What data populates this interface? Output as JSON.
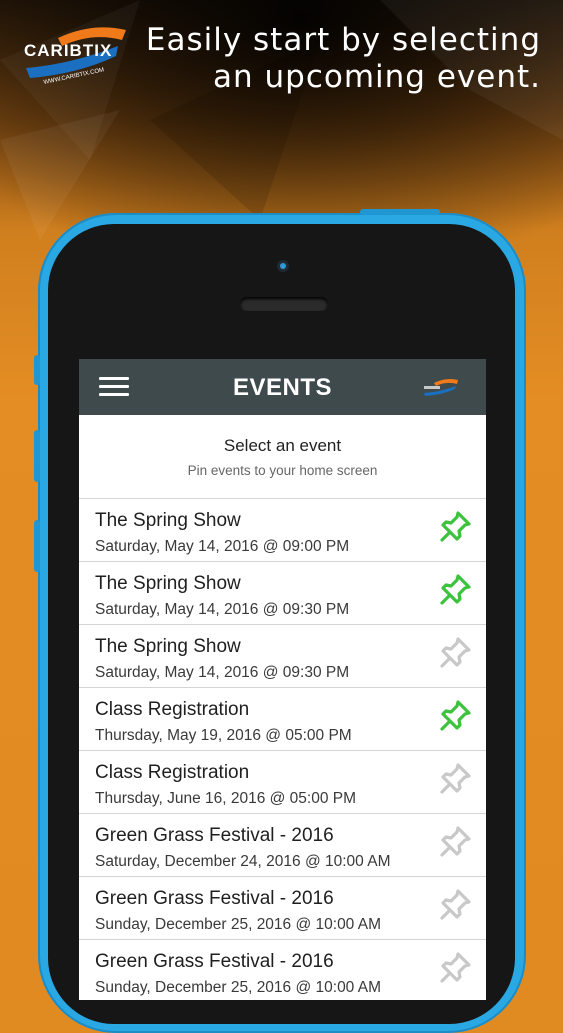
{
  "promo": {
    "logo_text": "CARIBTIX",
    "logo_url_text": "WWW.CARIBTIX.COM",
    "headline_line1": "Easily start by selecting",
    "headline_line2": "an upcoming event."
  },
  "appbar": {
    "menu_icon": "hamburger-menu-icon",
    "title": "EVENTS",
    "logo_icon": "caribtix-logo-icon"
  },
  "header": {
    "title": "Select an event",
    "subtitle": "Pin events to your home screen"
  },
  "colors": {
    "pinned": "#3cc23c",
    "unpinned": "#c8c8c8",
    "appbar": "#3f4a4d",
    "phone": "#29a8e4",
    "background": "#e08a22"
  },
  "events": [
    {
      "name": "The Spring Show",
      "date": "Saturday, May 14, 2016 @ 09:00 PM",
      "pinned": true
    },
    {
      "name": "The Spring Show",
      "date": "Saturday, May 14, 2016 @ 09:30 PM",
      "pinned": true
    },
    {
      "name": "The Spring Show",
      "date": "Saturday, May 14, 2016 @ 09:30 PM",
      "pinned": false
    },
    {
      "name": "Class Registration",
      "date": "Thursday, May 19, 2016 @ 05:00 PM",
      "pinned": true
    },
    {
      "name": "Class Registration",
      "date": "Thursday, June 16, 2016 @ 05:00 PM",
      "pinned": false
    },
    {
      "name": "Green Grass Festival - 2016",
      "date": "Saturday, December 24, 2016 @ 10:00 AM",
      "pinned": false
    },
    {
      "name": "Green Grass Festival - 2016",
      "date": "Sunday, December 25, 2016 @ 10:00 AM",
      "pinned": false
    },
    {
      "name": "Green Grass Festival - 2016",
      "date": "Sunday, December 25, 2016 @ 10:00 AM",
      "pinned": false
    }
  ]
}
